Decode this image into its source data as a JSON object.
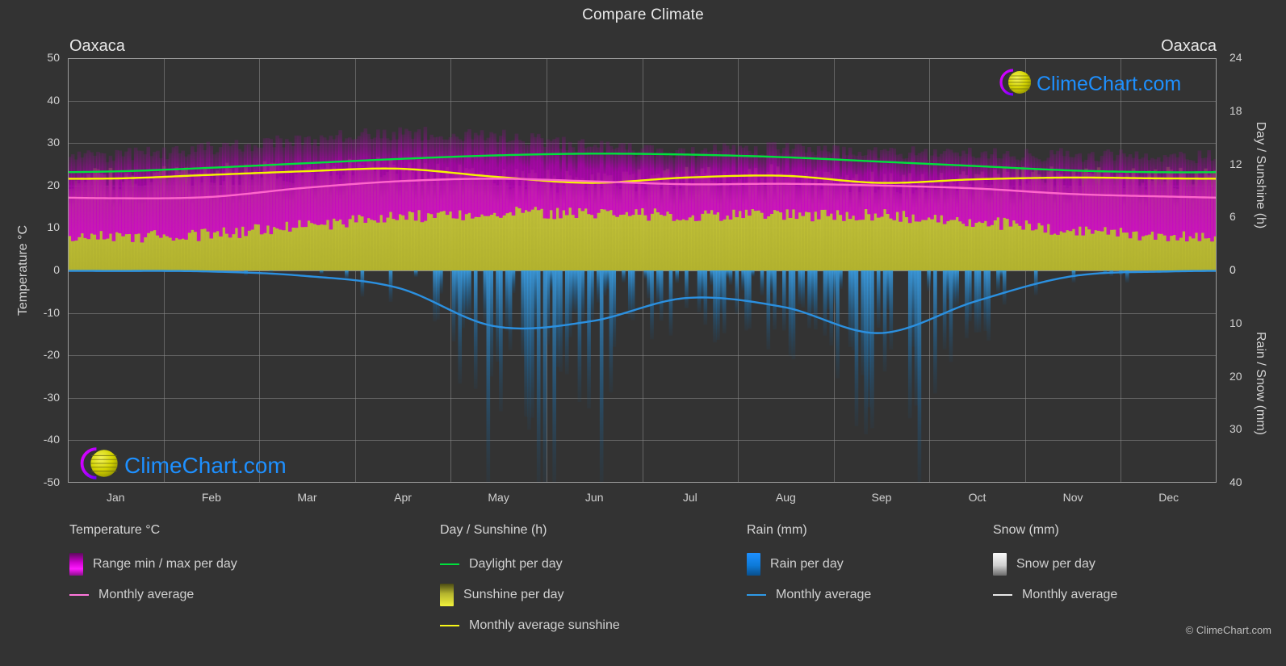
{
  "title": "Compare Climate",
  "location_left": "Oaxaca",
  "location_right": "Oaxaca",
  "copyright": "© ClimeChart.com",
  "brand": "ClimeChart.com",
  "axes": {
    "temperature_title": "Temperature °C",
    "day_sunshine_title": "Day / Sunshine (h)",
    "rain_snow_title": "Rain / Snow (mm)",
    "temperature_ticks": [
      "50",
      "40",
      "30",
      "20",
      "10",
      "0",
      "-10",
      "-20",
      "-30",
      "-40",
      "-50"
    ],
    "day_sunshine_ticks": [
      "24",
      "18",
      "12",
      "6",
      "0"
    ],
    "rain_snow_ticks": [
      "0",
      "10",
      "20",
      "30",
      "40"
    ],
    "month_ticks": [
      "Jan",
      "Feb",
      "Mar",
      "Apr",
      "May",
      "Jun",
      "Jul",
      "Aug",
      "Sep",
      "Oct",
      "Nov",
      "Dec"
    ]
  },
  "legend": {
    "temperature": {
      "header": "Temperature °C",
      "items": [
        {
          "label": "Range min / max per day",
          "marker": "gradient-box",
          "color": "#ff00ff"
        },
        {
          "label": "Monthly average",
          "marker": "line",
          "color": "#ff77dd"
        }
      ]
    },
    "day_sunshine": {
      "header": "Day / Sunshine (h)",
      "items": [
        {
          "label": "Daylight per day",
          "marker": "line",
          "color": "#00e13c"
        },
        {
          "label": "Sunshine per day",
          "marker": "gradient-box",
          "color": "#f2f23c"
        },
        {
          "label": "Monthly average sunshine",
          "marker": "line",
          "color": "#f7f718"
        }
      ]
    },
    "rain": {
      "header": "Rain (mm)",
      "items": [
        {
          "label": "Rain per day",
          "marker": "gradient-box",
          "color": "#0d8ae8"
        },
        {
          "label": "Monthly average",
          "marker": "line",
          "color": "#2f9ae8"
        }
      ]
    },
    "snow": {
      "header": "Snow (mm)",
      "items": [
        {
          "label": "Snow per day",
          "marker": "gradient-box",
          "color": "#f0f0f0"
        },
        {
          "label": "Monthly average",
          "marker": "line",
          "color": "#e8e8e8"
        }
      ]
    }
  },
  "colors": {
    "background": "#333333",
    "grid": "#8f8f8f",
    "text": "#d0d0d0",
    "temp_range": "#cc00cc",
    "temp_avg": "#ff66cc",
    "daylight": "#00e13c",
    "sunshine_band": "#a8a832",
    "sunshine_avg": "#f5f500",
    "rain_band": "#1a6fb0",
    "rain_avg": "#2b90e0",
    "brand_blue": "#1e90ff",
    "brand_magenta": "#cc00ff",
    "brand_yellow": "#d4d400"
  },
  "chart_data": {
    "type": "area",
    "title": "Compare Climate",
    "subtitle": "Oaxaca",
    "xlabel": "",
    "ylabel": "Temperature °C",
    "ylim": [
      -50,
      50
    ],
    "y2lim_day_sunshine": [
      0,
      24
    ],
    "y2lim_rain_snow": [
      0,
      40
    ],
    "grid": true,
    "legend_position": "below",
    "categories": [
      "Jan",
      "Feb",
      "Mar",
      "Apr",
      "May",
      "Jun",
      "Jul",
      "Aug",
      "Sep",
      "Oct",
      "Nov",
      "Dec"
    ],
    "series": [
      {
        "name": "Temperature monthly average (°C)",
        "unit": "°C",
        "axis": "left",
        "color": "#ff66cc",
        "values": [
          17.0,
          17.3,
          19.4,
          21.0,
          21.6,
          21.0,
          20.3,
          20.4,
          20.0,
          19.3,
          18.0,
          17.4
        ]
      },
      {
        "name": "Temperature daily max (approx °C)",
        "unit": "°C",
        "axis": "left",
        "color": "#cc00cc",
        "values": [
          27.0,
          28.5,
          30.5,
          32.0,
          31.5,
          29.0,
          28.0,
          28.5,
          27.5,
          27.5,
          27.0,
          26.5
        ]
      },
      {
        "name": "Temperature daily min (approx °C)",
        "unit": "°C",
        "axis": "left",
        "color": "#cc00cc",
        "values": [
          8.0,
          8.5,
          10.5,
          12.5,
          13.5,
          13.5,
          13.0,
          13.0,
          13.0,
          11.5,
          9.5,
          8.0
        ]
      },
      {
        "name": "Daylight per day (h)",
        "unit": "h",
        "axis": "right_day",
        "color": "#00e13c",
        "values": [
          11.2,
          11.6,
          12.1,
          12.6,
          13.0,
          13.2,
          13.1,
          12.8,
          12.3,
          11.8,
          11.3,
          11.1
        ]
      },
      {
        "name": "Monthly average sunshine (h)",
        "unit": "h",
        "axis": "right_day",
        "color": "#f5f500",
        "values": [
          10.4,
          10.8,
          11.2,
          11.5,
          10.6,
          9.9,
          10.5,
          10.7,
          9.9,
          10.3,
          10.5,
          10.4
        ]
      },
      {
        "name": "Rain monthly average (mm/day)",
        "unit": "mm",
        "axis": "right_rain",
        "color": "#2b90e0",
        "values": [
          0.1,
          0.2,
          1.0,
          3.3,
          10.5,
          9.6,
          5.2,
          6.9,
          11.8,
          5.8,
          1.1,
          0.2
        ]
      },
      {
        "name": "Snow monthly average (mm/day)",
        "unit": "mm",
        "axis": "right_rain",
        "color": "#e8e8e8",
        "values": [
          0,
          0,
          0,
          0,
          0,
          0,
          0,
          0,
          0,
          0,
          0,
          0
        ]
      }
    ]
  }
}
